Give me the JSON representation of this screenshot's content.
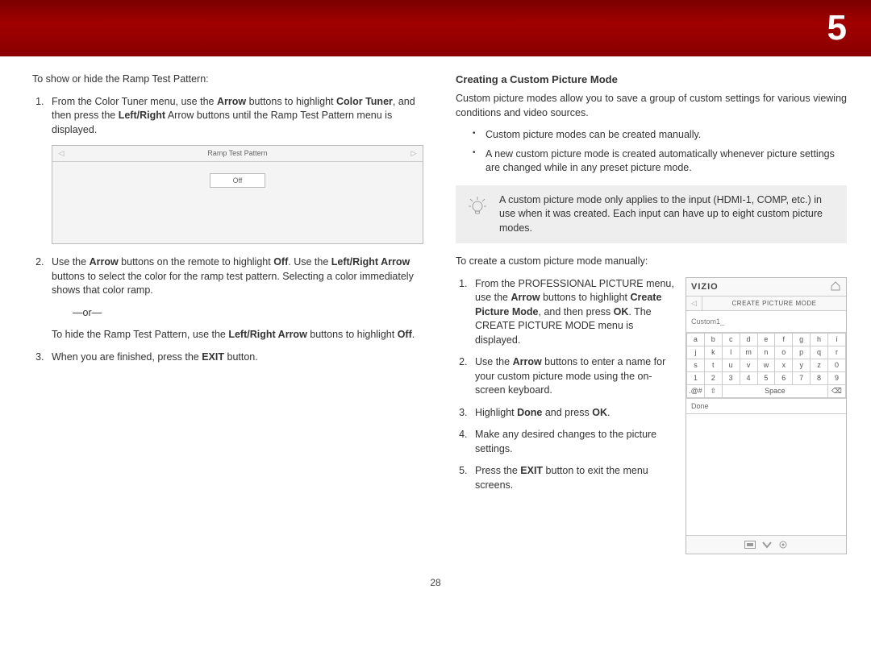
{
  "header": {
    "page_chapter": "5"
  },
  "left": {
    "intro": "To show or hide the Ramp Test Pattern:",
    "step1_a": "From the Color Tuner menu, use the ",
    "step1_b": "Arrow",
    "step1_c": " buttons to highlight ",
    "step1_d": "Color Tuner",
    "step1_e": ", and then press the ",
    "step1_f": "Left/Right",
    "step1_g": " Arrow buttons until the Ramp Test Pattern menu is displayed.",
    "ramp_title": "Ramp Test Pattern",
    "ramp_value": "Off",
    "step2_a": "Use the ",
    "step2_b": "Arrow",
    "step2_c": " buttons on the remote to highlight ",
    "step2_d": "Off",
    "step2_e": ". Use the ",
    "step2_f": "Left/Right Arrow",
    "step2_g": " buttons to select the color for the ramp test pattern. Selecting a color immediately shows that color ramp.",
    "or": "—or—",
    "step2h_a": "To hide the Ramp Test Pattern, use the ",
    "step2h_b": "Left/Right Arrow",
    "step2h_c": " buttons to highlight ",
    "step2h_d": "Off",
    "step2h_e": ".",
    "step3_a": "When you are finished, press the ",
    "step3_b": "EXIT",
    "step3_c": " button."
  },
  "right": {
    "heading": "Creating a Custom Picture Mode",
    "intro": "Custom picture modes allow you to save a group of custom settings for various viewing conditions and video sources.",
    "bullet1": "Custom picture modes can be created manually.",
    "bullet2": "A new custom picture mode is created automatically whenever picture settings are changed while in any preset picture mode.",
    "tip": "A custom picture mode only applies to the input (HDMI-1, COMP, etc.) in use when it was created. Each input can have up to eight custom picture modes.",
    "create_intro": "To create a custom picture mode manually:",
    "s1_a": "From the PROFESSIONAL PICTURE menu, use the ",
    "s1_b": "Arrow",
    "s1_c": " buttons to highlight ",
    "s1_d": "Create Picture Mode",
    "s1_e": ", and then press ",
    "s1_f": "OK",
    "s1_g": ". The CREATE PICTURE MODE menu is displayed.",
    "s2_a": "Use the ",
    "s2_b": "Arrow",
    "s2_c": " buttons to enter a name for your custom picture mode using the on-screen keyboard.",
    "s3_a": "Highlight ",
    "s3_b": "Done",
    "s3_c": " and press ",
    "s3_d": "OK",
    "s3_e": ".",
    "s4": "Make any desired changes to the picture settings.",
    "s5_a": "Press the ",
    "s5_b": "EXIT",
    "s5_c": " button to exit the menu screens."
  },
  "device": {
    "logo": "VIZIO",
    "bar_title": "CREATE PICTURE MODE",
    "input_value": "Custom1_",
    "keys_row1": [
      "a",
      "b",
      "c",
      "d",
      "e",
      "f",
      "g",
      "h",
      "i"
    ],
    "keys_row2": [
      "j",
      "k",
      "l",
      "m",
      "n",
      "o",
      "p",
      "q",
      "r"
    ],
    "keys_row3": [
      "s",
      "t",
      "u",
      "v",
      "w",
      "x",
      "y",
      "z",
      "0"
    ],
    "keys_row4": [
      "1",
      "2",
      "3",
      "4",
      "5",
      "6",
      "7",
      "8",
      "9"
    ],
    "sym_key": ".@#",
    "shift_key": "⇧",
    "space_key": "Space",
    "del_key": "⌫",
    "done": "Done"
  },
  "footer": {
    "page": "28"
  }
}
